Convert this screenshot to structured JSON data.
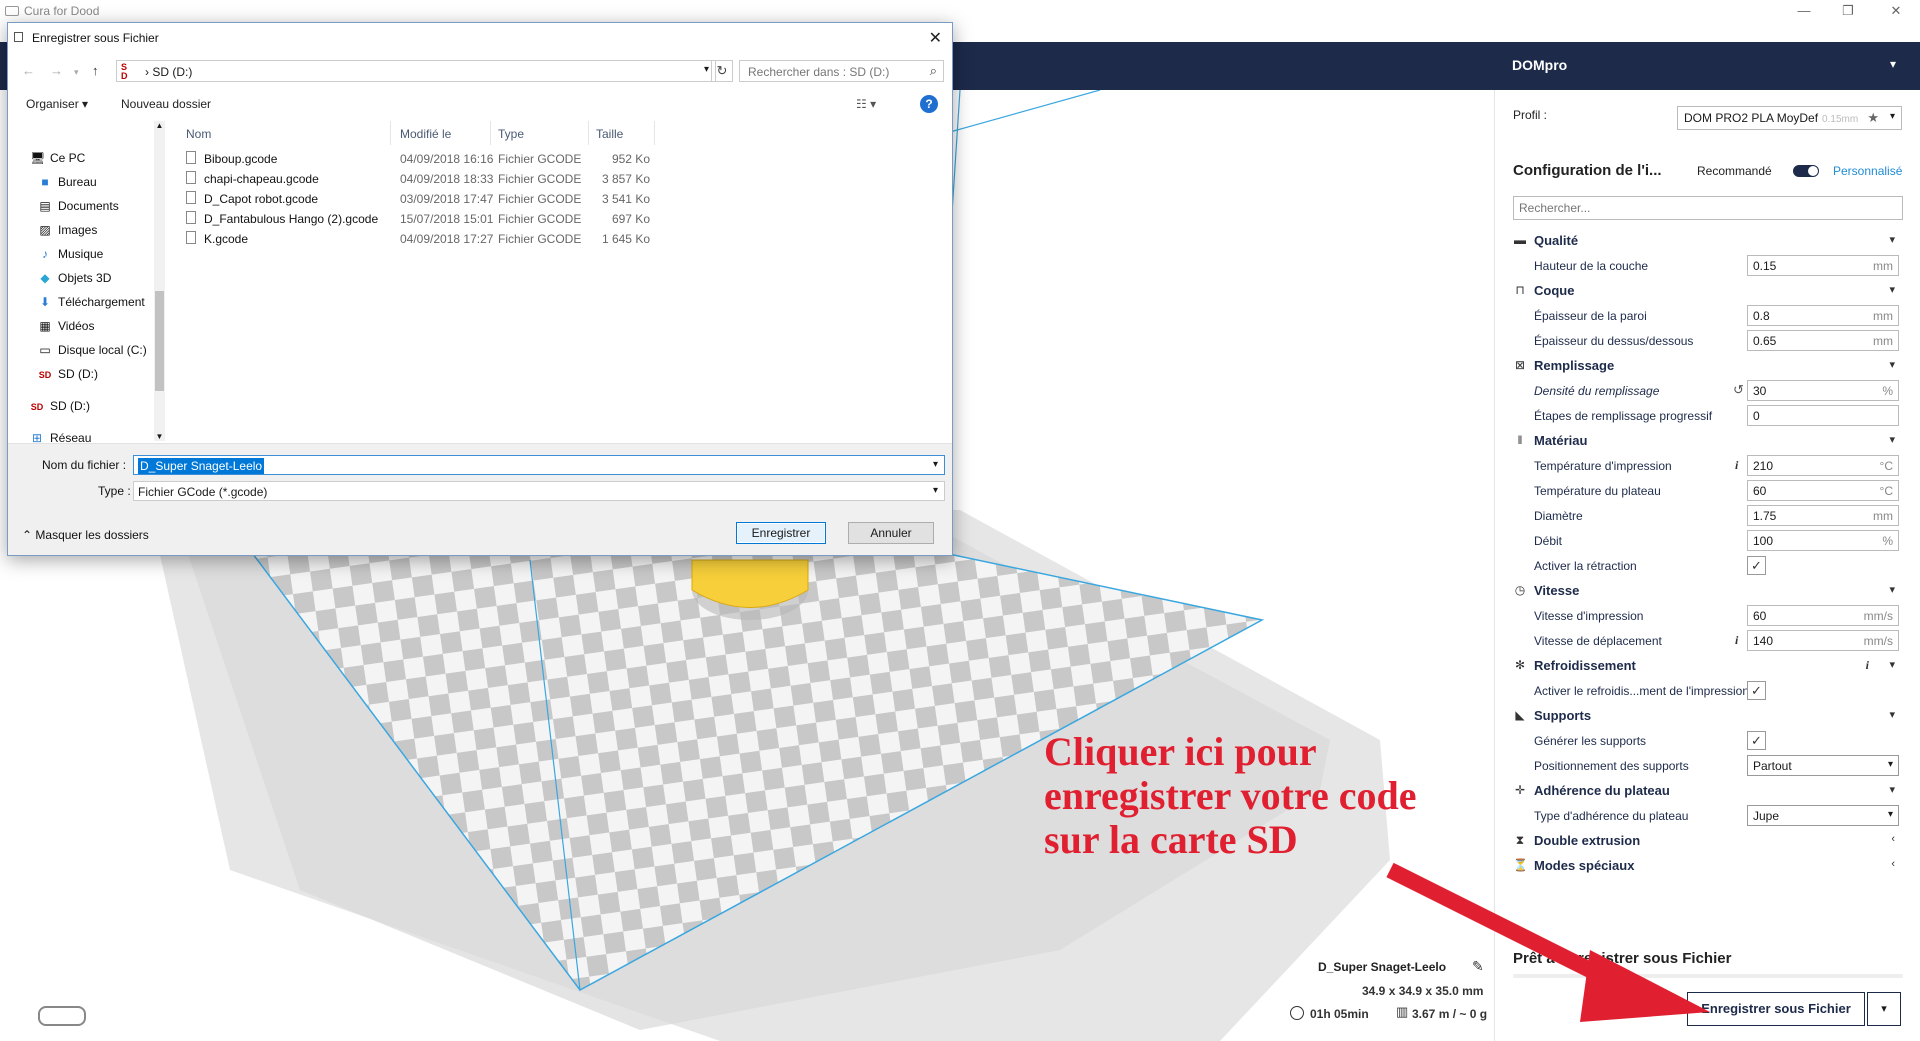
{
  "app": {
    "title": "Cura for Dood"
  },
  "header": {
    "printer_name": "DOMpro"
  },
  "panel": {
    "profile_label": "Profil :",
    "profile_value": "DOM PRO2 PLA MoyDef",
    "profile_sub": "0.15mm",
    "config_title": "Configuration de l'i...",
    "mode_recommended": "Recommandé",
    "mode_custom": "Personnalisé",
    "search_placeholder": "Rechercher...",
    "categories": [
      {
        "label": "Qualité",
        "icon": "quality-icon",
        "chevron": "expanded"
      },
      {
        "label": "Coque",
        "icon": "shell-icon",
        "chevron": "expanded"
      },
      {
        "label": "Remplissage",
        "icon": "infill-icon",
        "chevron": "expanded"
      },
      {
        "label": "Matériau",
        "icon": "material-icon",
        "chevron": "expanded"
      },
      {
        "label": "Vitesse",
        "icon": "speed-icon",
        "chevron": "expanded"
      },
      {
        "label": "Refroidissement",
        "icon": "cooling-icon",
        "chevron": "expanded",
        "info": "i"
      },
      {
        "label": "Supports",
        "icon": "support-icon",
        "chevron": "expanded"
      },
      {
        "label": "Adhérence du plateau",
        "icon": "adhesion-icon",
        "chevron": "expanded"
      },
      {
        "label": "Double extrusion",
        "icon": "dual-extrusion-icon",
        "chevron": "collapsed"
      },
      {
        "label": "Modes spéciaux",
        "icon": "special-modes-icon",
        "chevron": "collapsed"
      }
    ],
    "settings": {
      "layer_height": {
        "label": "Hauteur de la couche",
        "value": "0.15",
        "unit": "mm"
      },
      "wall_thickness": {
        "label": "Épaisseur de la paroi",
        "value": "0.8",
        "unit": "mm"
      },
      "top_bottom_thickness": {
        "label": "Épaisseur du dessus/dessous",
        "value": "0.65",
        "unit": "mm"
      },
      "infill_density": {
        "label": "Densité du remplissage",
        "value": "30",
        "unit": "%"
      },
      "gradual_infill": {
        "label": "Étapes de remplissage progressif",
        "value": "0"
      },
      "print_temp": {
        "label": "Température d'impression",
        "value": "210",
        "unit": "°C",
        "info": "i"
      },
      "bed_temp": {
        "label": "Température du plateau",
        "value": "60",
        "unit": "°C"
      },
      "diameter": {
        "label": "Diamètre",
        "value": "1.75",
        "unit": "mm"
      },
      "flow": {
        "label": "Débit",
        "value": "100",
        "unit": "%"
      },
      "retraction": {
        "label": "Activer la rétraction",
        "checked": "✓"
      },
      "print_speed": {
        "label": "Vitesse d'impression",
        "value": "60",
        "unit": "mm/s"
      },
      "travel_speed": {
        "label": "Vitesse de déplacement",
        "value": "140",
        "unit": "mm/s",
        "info": "i"
      },
      "cooling": {
        "label": "Activer le refroidis...ment de l'impression",
        "checked": "✓"
      },
      "gen_supports": {
        "label": "Générer les supports",
        "checked": "✓"
      },
      "support_placement": {
        "label": "Positionnement des supports",
        "value": "Partout"
      },
      "adhesion_type": {
        "label": "Type d'adhérence du plateau",
        "value": "Jupe"
      }
    },
    "ready_title": "Prêt à Enregistrer sous Fichier",
    "save_button": "Enregistrer sous Fichier"
  },
  "job": {
    "name": "D_Super Snaget-Leelo",
    "dims": "34.9 x 34.9 x 35.0 mm",
    "time": "01h 05min",
    "material": "3.67 m / ~ 0 g"
  },
  "annotation": {
    "line1": "Cliquer ici pour",
    "line2": "enregistrer votre code",
    "line3": "sur la carte SD",
    "color": "#e02030"
  },
  "dialog": {
    "title": "Enregistrer sous Fichier",
    "address_path": "SD (D:)",
    "search_placeholder": "Rechercher dans : SD (D:)",
    "toolbar": {
      "organize": "Organiser ▾",
      "new_folder": "Nouveau dossier"
    },
    "nav": [
      {
        "label": "Ce PC",
        "icon": "pc-icon"
      },
      {
        "label": "Bureau",
        "icon": "desktop-icon"
      },
      {
        "label": "Documents",
        "icon": "documents-icon"
      },
      {
        "label": "Images",
        "icon": "images-icon"
      },
      {
        "label": "Musique",
        "icon": "music-icon"
      },
      {
        "label": "Objets 3D",
        "icon": "objects3d-icon"
      },
      {
        "label": "Téléchargement",
        "icon": "download-icon"
      },
      {
        "label": "Vidéos",
        "icon": "videos-icon"
      },
      {
        "label": "Disque local (C:)",
        "icon": "disk-icon"
      },
      {
        "label": "SD (D:)",
        "icon": "sd-icon"
      },
      {
        "label": "SD (D:)",
        "icon": "sd-icon"
      },
      {
        "label": "Réseau",
        "icon": "network-icon"
      }
    ],
    "columns": [
      "Nom",
      "Modifié le",
      "Type",
      "Taille"
    ],
    "files": [
      {
        "name": "Biboup.gcode",
        "date": "04/09/2018 16:16",
        "type": "Fichier GCODE",
        "size": "952 Ko"
      },
      {
        "name": "chapi-chapeau.gcode",
        "date": "04/09/2018 18:33",
        "type": "Fichier GCODE",
        "size": "3 857 Ko"
      },
      {
        "name": "D_Capot robot.gcode",
        "date": "03/09/2018 17:47",
        "type": "Fichier GCODE",
        "size": "3 541 Ko"
      },
      {
        "name": "D_Fantabulous Hango (2).gcode",
        "date": "15/07/2018 15:01",
        "type": "Fichier GCODE",
        "size": "697 Ko"
      },
      {
        "name": "K.gcode",
        "date": "04/09/2018 17:27",
        "type": "Fichier GCODE",
        "size": "1 645 Ko"
      }
    ],
    "filename_label": "Nom du fichier :",
    "filename_value": "D_Super Snaget-Leelo",
    "type_label": "Type :",
    "type_value": "Fichier GCode (*.gcode)",
    "hide_folders": "Masquer les dossiers",
    "save_button": "Enregistrer",
    "cancel_button": "Annuler"
  },
  "colors": {
    "header": "#1d2a4a",
    "accent": "#1f8cd6",
    "annotation": "#e02030"
  }
}
